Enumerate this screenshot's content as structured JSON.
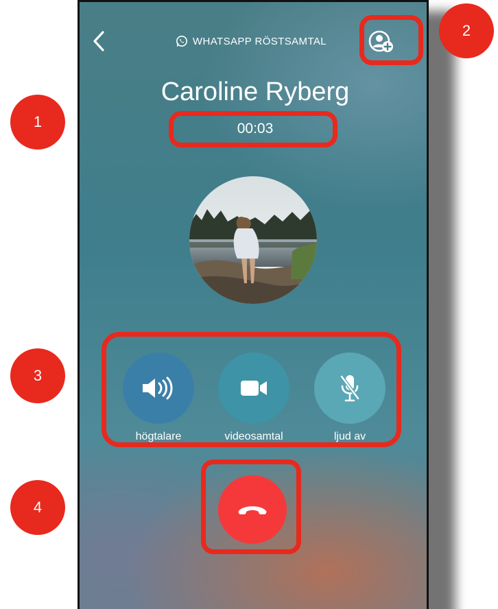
{
  "call": {
    "title": "WHATSAPP RÖSTSAMTAL",
    "caller_name": "Caroline Ryberg",
    "timer": "00:03"
  },
  "controls": [
    {
      "label": "högtalare",
      "icon": "speaker-icon",
      "color": "#3a7fa8"
    },
    {
      "label": "videosamtal",
      "icon": "video-camera-icon",
      "color": "#3e93a6"
    },
    {
      "label": "ljud av",
      "icon": "microphone-muted-icon",
      "color": "#5aa7b5"
    }
  ],
  "end_call": {
    "icon": "phone-hangup-icon",
    "color": "#f5393a"
  },
  "annotations": {
    "badges": [
      "1",
      "2",
      "3",
      "4"
    ],
    "color": "#e8291d"
  }
}
